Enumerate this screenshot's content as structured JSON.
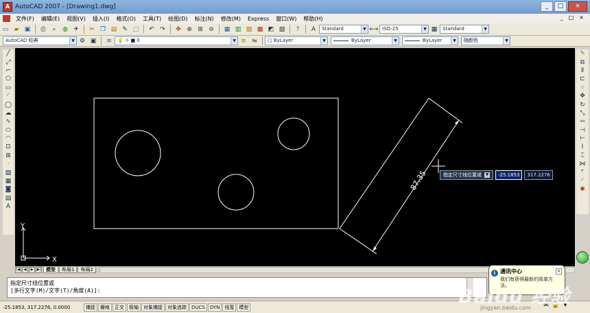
{
  "window": {
    "title": "AutoCAD 2007 - [Drawing1.dwg]",
    "app_icon_glyph": "A",
    "controls": [
      "_",
      "□",
      "×"
    ]
  },
  "menu": [
    "文件(F)",
    "编辑(E)",
    "视图(V)",
    "插入(I)",
    "格式(O)",
    "工具(T)",
    "绘图(D)",
    "标注(N)",
    "修改(M)",
    "Express",
    "窗口(W)",
    "帮助(H)"
  ],
  "doc_controls": [
    "_",
    "□",
    "×"
  ],
  "toolbar1": {
    "text_style": "Standard",
    "dim_style": "ISO-25",
    "table_style": "Standard"
  },
  "toolbar2": {
    "workspace": "AutoCAD 经典",
    "layer": "0",
    "color": "ByLayer",
    "linetype": "ByLayer",
    "lineweight": "ByLayer",
    "plotstyle": "随颜色"
  },
  "drawing": {
    "dimension_text": "87.35",
    "ucs_x": "X",
    "ucs_y": "Y"
  },
  "dim_prompt": {
    "label": "指定尺寸线位置或",
    "value1": "-25.1853",
    "value2": "317.2276"
  },
  "layout_tabs": {
    "nav": [
      "|◀",
      "◀",
      "▶",
      "▶|"
    ],
    "tabs": [
      "模型",
      "布局1",
      "布局2"
    ],
    "active": "模型"
  },
  "command": {
    "line1": "指定尺寸线位置或",
    "line2": "[多行文字(M)/文字(T)/角度(A)]:"
  },
  "status": {
    "coords": "-25.1853, 317.2276, 0.0000",
    "buttons": [
      "捕捉",
      "栅格",
      "正交",
      "极轴",
      "对象捕捉",
      "对象追踪",
      "DUCS",
      "DYN",
      "线宽",
      "模型"
    ]
  },
  "balloon": {
    "title": "通讯中心",
    "body": "我们有获得最新的简单方法。"
  },
  "watermark": {
    "logo": "Baidu 经验",
    "url": "jingyan.baidu.com"
  },
  "colors": {
    "canvas": "#000000",
    "geometry": "#ffffff",
    "highlight": "#0a246a"
  }
}
